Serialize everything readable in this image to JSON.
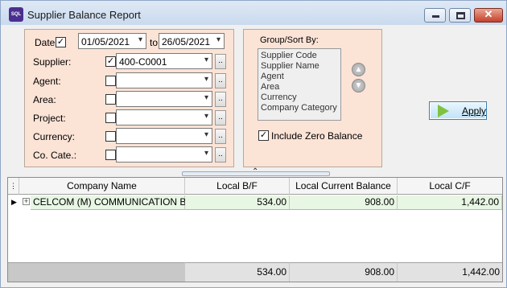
{
  "window": {
    "title": "Supplier Balance Report",
    "app_icon_text": "SQL"
  },
  "filters": {
    "date_label": "Date",
    "date_checked": true,
    "date_from": "01/05/2021",
    "date_to_label": "to",
    "date_to": "26/05/2021",
    "rows": [
      {
        "label": "Supplier:",
        "checked": true,
        "value": "400-C0001"
      },
      {
        "label": "Agent:",
        "checked": false,
        "value": ""
      },
      {
        "label": "Area:",
        "checked": false,
        "value": ""
      },
      {
        "label": "Project:",
        "checked": false,
        "value": ""
      },
      {
        "label": "Currency:",
        "checked": false,
        "value": ""
      },
      {
        "label": "Co. Cate.:",
        "checked": false,
        "value": ""
      }
    ],
    "browse_label": ".."
  },
  "group_sort": {
    "title": "Group/Sort By:",
    "items": [
      "Supplier Code",
      "Supplier Name",
      "Agent",
      "Area",
      "Currency",
      "Company Category"
    ],
    "include_zero_label": "Include Zero Balance",
    "include_zero_checked": true
  },
  "apply_label": "Apply",
  "grid": {
    "columns": [
      "Company Name",
      "Local B/F",
      "Local Current Balance",
      "Local C/F"
    ],
    "rows": [
      {
        "company": "CELCOM (M) COMMUNICATION BHD",
        "bf": "534.00",
        "current": "908.00",
        "cf": "1,442.00"
      }
    ],
    "footer": {
      "bf": "534.00",
      "current": "908.00",
      "cf": "1,442.00"
    }
  },
  "colors": {
    "panel_bg": "#fbe3d6",
    "row_bg": "#e8f6e4",
    "apply_icon": "#7fc241"
  }
}
